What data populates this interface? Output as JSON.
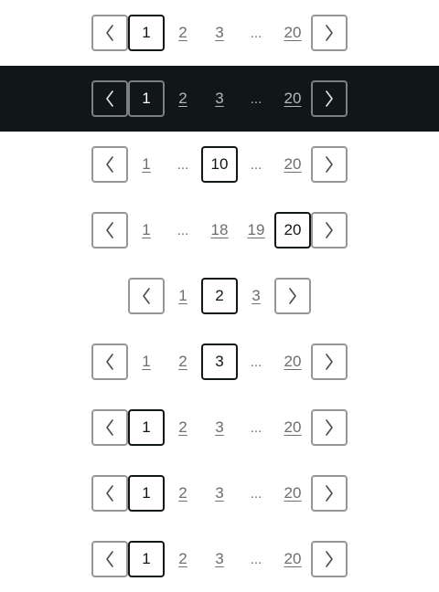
{
  "theme": {
    "dark_background": "#111619",
    "current_border": "#111619",
    "arrow_border": "#969696",
    "link_color": "#6e6e6e"
  },
  "icons": {
    "prev": "chevron-left-icon",
    "next": "chevron-right-icon"
  },
  "paginations": [
    {
      "variant": "default",
      "items": [
        "1",
        "2",
        "3",
        "...",
        "20"
      ],
      "current": "1"
    },
    {
      "variant": "dark",
      "items": [
        "1",
        "2",
        "3",
        "...",
        "20"
      ],
      "current": "1"
    },
    {
      "variant": "default",
      "items": [
        "1",
        "...",
        "10",
        "...",
        "20"
      ],
      "current": "10"
    },
    {
      "variant": "default",
      "items": [
        "1",
        "...",
        "18",
        "19",
        "20"
      ],
      "current": "20"
    },
    {
      "variant": "default",
      "items": [
        "1",
        "2",
        "3"
      ],
      "current": "2"
    },
    {
      "variant": "default",
      "items": [
        "1",
        "2",
        "3",
        "...",
        "20"
      ],
      "current": "3"
    },
    {
      "variant": "default",
      "items": [
        "1",
        "2",
        "3",
        "...",
        "20"
      ],
      "current": "1"
    },
    {
      "variant": "default",
      "items": [
        "1",
        "2",
        "3",
        "...",
        "20"
      ],
      "current": "1"
    },
    {
      "variant": "default",
      "items": [
        "1",
        "2",
        "3",
        "...",
        "20"
      ],
      "current": "1"
    }
  ]
}
